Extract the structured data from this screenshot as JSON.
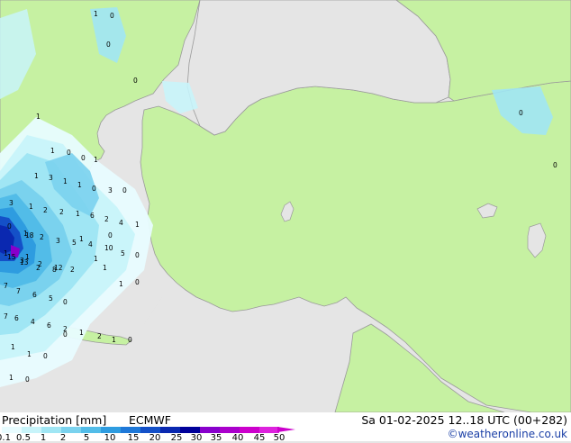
{
  "footer": {
    "title": "Precipitation [mm]",
    "model": "ECMWF",
    "datetime": "Sa 01-02-2025 12..18 UTC (00+282)",
    "credit": "©weatheronline.co.uk"
  },
  "legend": {
    "ticks": [
      "0.1",
      "0.5",
      "1",
      "2",
      "5",
      "10",
      "15",
      "20",
      "25",
      "30",
      "35",
      "40",
      "45",
      "50"
    ],
    "colors": [
      "#e8fcff",
      "#c8f4fa",
      "#a0e6f4",
      "#7ad2ee",
      "#52bce8",
      "#2e9ce0",
      "#1e78d8",
      "#1450c8",
      "#0a28b0",
      "#00009a",
      "#8800cc",
      "#aa00cc",
      "#cc00cc",
      "#dd22dd"
    ]
  },
  "map_colors": {
    "sea": "#e5e5e5",
    "land": "#c6f1a2",
    "coast": "#9a9a9a"
  },
  "precip_labels": [
    "1",
    "0",
    "0",
    "0",
    "0",
    "1",
    "0",
    "1",
    "0",
    "0",
    "1",
    "1",
    "3",
    "1",
    "1",
    "0",
    "3",
    "0",
    "3",
    "1",
    "2",
    "2",
    "1",
    "6",
    "2",
    "4",
    "1",
    "0",
    "1",
    "2",
    "3",
    "5",
    "4",
    "10",
    "5",
    "0",
    "1",
    "3",
    "2",
    "12",
    "2",
    "15",
    "1",
    "18",
    "2",
    "13",
    "8",
    "1",
    "1",
    "0",
    "7",
    "6",
    "5",
    "0",
    "7",
    "7",
    "6",
    "4",
    "6",
    "2",
    "1",
    "2",
    "1",
    "0",
    "1",
    "1",
    "0",
    "1",
    "0",
    "0",
    "1",
    "1",
    "0"
  ]
}
